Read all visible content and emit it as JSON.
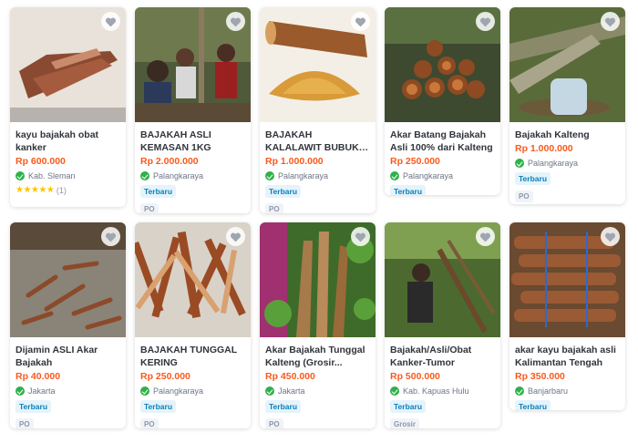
{
  "products": [
    {
      "name": "kayu bajakah obat kanker",
      "price": "Rp 600.000",
      "location": "Kab. Sleman",
      "rating": "(1)",
      "stars": "★★★★★",
      "tags": []
    },
    {
      "name": "BAJAKAH ASLI KEMASAN 1KG",
      "price": "Rp 2.000.000",
      "location": "Palangkaraya",
      "tags": [
        "Terbaru",
        "PO"
      ]
    },
    {
      "name": "BAJAKAH KALALAWIT BUBUK DAN AKAR...",
      "price": "Rp 1.000.000",
      "location": "Palangkaraya",
      "tags": [
        "Terbaru",
        "PO"
      ]
    },
    {
      "name": "Akar Batang Bajakah Asli 100% dari Kalteng",
      "price": "Rp 250.000",
      "location": "Palangkaraya",
      "tags": [
        "Terbaru"
      ]
    },
    {
      "name": "Bajakah Kalteng",
      "price": "Rp 1.000.000",
      "location": "Palangkaraya",
      "tags": [
        "Terbaru",
        "PO"
      ]
    },
    {
      "name": "Dijamin ASLI Akar Bajakah",
      "price": "Rp 40.000",
      "location": "Jakarta",
      "tags": [
        "Terbaru",
        "PO"
      ]
    },
    {
      "name": "BAJAKAH TUNGGAL KERING",
      "price": "Rp 250.000",
      "location": "Palangkaraya",
      "tags": [
        "Terbaru",
        "PO"
      ]
    },
    {
      "name": "Akar Bajakah Tunggal Kalteng (Grosir...",
      "price": "Rp 450.000",
      "location": "Jakarta",
      "tags": [
        "Terbaru",
        "PO"
      ]
    },
    {
      "name": "Bajakah/Asli/Obat Kanker-Tumor",
      "price": "Rp 500.000",
      "location": "Kab. Kapuas Hulu",
      "tags": [
        "Terbaru",
        "Grosir"
      ]
    },
    {
      "name": "akar kayu bajakah asli Kalimantan Tengah",
      "price": "Rp 350.000",
      "location": "Banjarbaru",
      "tags": [
        "Terbaru"
      ]
    }
  ],
  "colors": {
    "price": "#fa591d",
    "badge": "#2fb14a",
    "tag_text": "#0a80b8",
    "tag_bg": "#e5f3fb"
  },
  "icons": {
    "wishlist": "heart-icon",
    "shop_badge": "check-badge-icon",
    "rating": "star-icon"
  }
}
